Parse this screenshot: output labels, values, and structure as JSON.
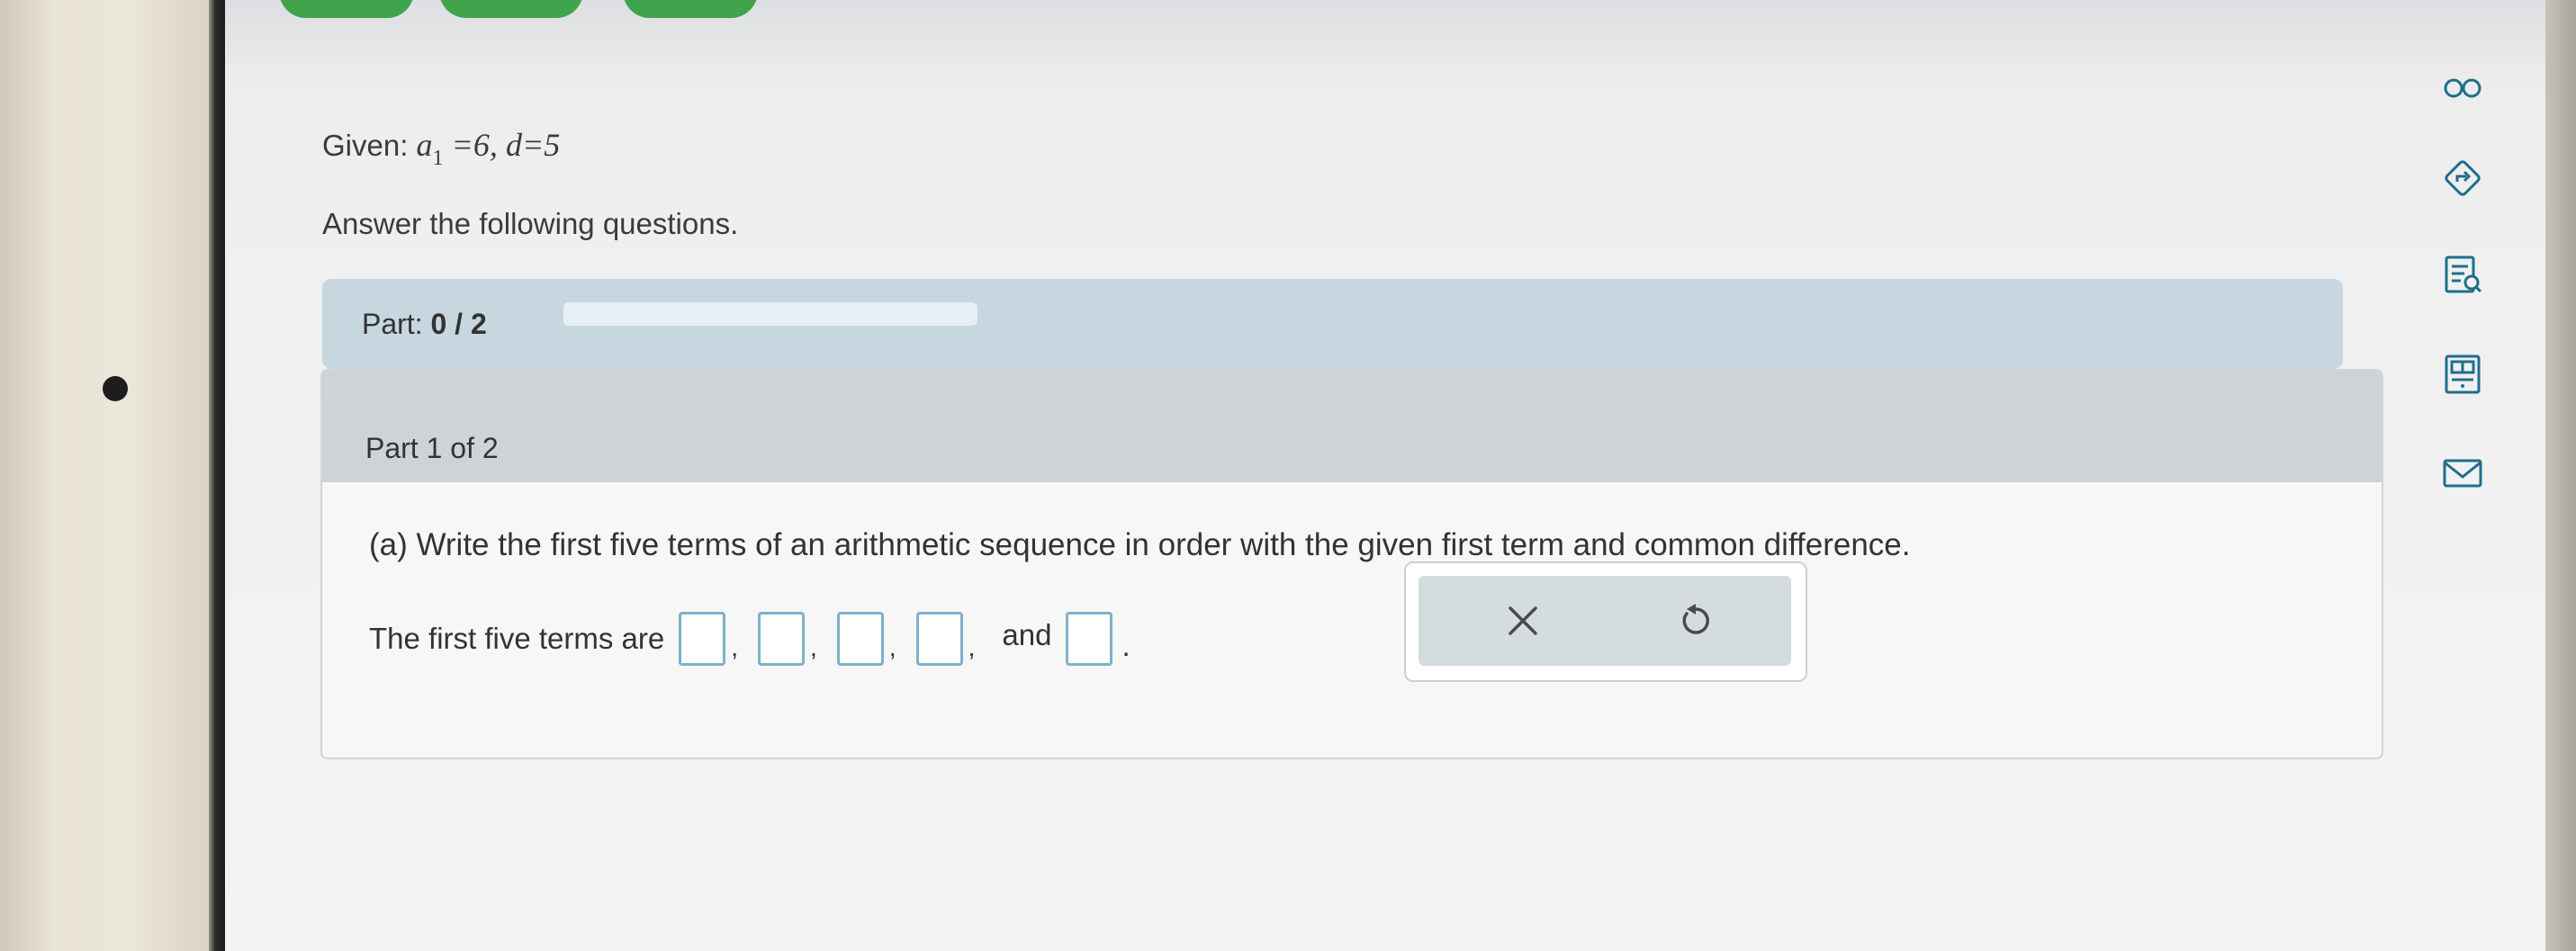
{
  "problem": {
    "given_label": "Given:",
    "a1_symbol": "a",
    "a1_subscript": "1",
    "a1_value": "=6,",
    "d_expr": "d=5",
    "instructions": "Answer the following questions."
  },
  "part_progress": {
    "label": "Part:",
    "value": "0 / 2",
    "fraction_complete": 0
  },
  "question": {
    "part_header": "Part 1 of 2",
    "prompt": "(a) Write the first five terms of an arithmetic sequence in order with the given first term and common difference.",
    "answer_lead": "The first five terms are",
    "separator": ",",
    "conjunction": "and",
    "terminator": ".",
    "answer_values": [
      "",
      "",
      "",
      "",
      ""
    ]
  },
  "controls": {
    "clear_icon": "x-icon",
    "undo_icon": "undo-icon"
  },
  "toolbar": {
    "icons": [
      "infinity-icon",
      "arrow-diamond-icon",
      "document-search-icon",
      "calculator-icon",
      "mail-icon"
    ]
  },
  "colors": {
    "part_bar": "#c8d6e0",
    "card_header": "#cdd3d7",
    "answer_box_border": "#7fb0c9",
    "toolbar_icon": "#1f6e8c",
    "top_tabs": "#3fa44b"
  }
}
